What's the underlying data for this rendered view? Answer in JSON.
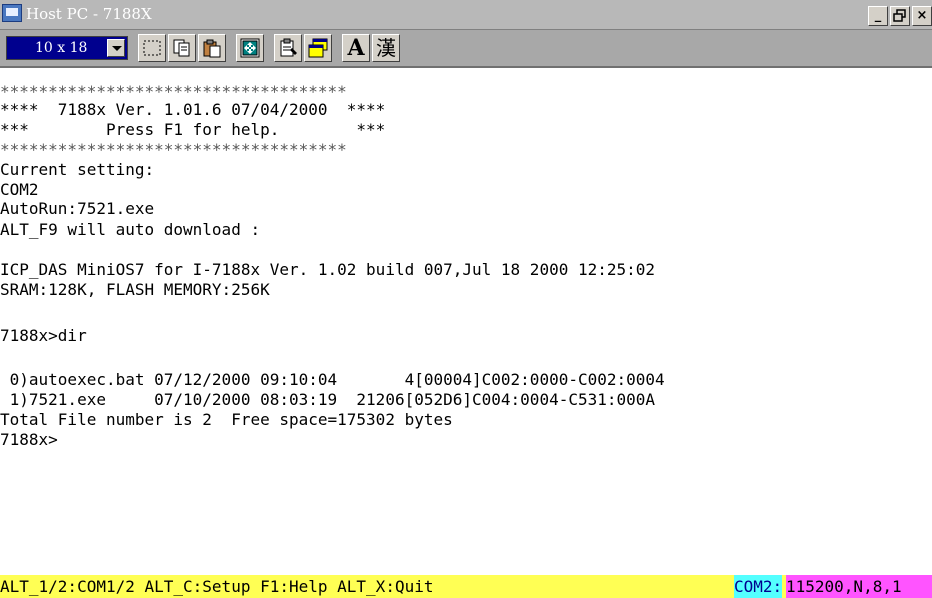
{
  "window": {
    "title": "Host PC - 7188X",
    "minimize_label": "_",
    "restore_label": "▫",
    "close_label": "×"
  },
  "toolbar": {
    "font_size": "10 x 18",
    "buttons": [
      {
        "icon": "select-icon"
      },
      {
        "icon": "copy-icon"
      },
      {
        "icon": "paste-icon"
      },
      {
        "icon": "fullscreen-icon"
      },
      {
        "icon": "properties-icon"
      },
      {
        "icon": "window-icon"
      },
      {
        "icon": "font-icon",
        "label": "A"
      },
      {
        "icon": "chinese-font-icon",
        "label": "漢"
      }
    ]
  },
  "terminal": {
    "lines": [
      "************************************",
      "****  7188x Ver. 1.01.6 07/04/2000  ****",
      "***        Press F1 for help.        ***",
      "************************************",
      "Current setting:",
      "COM2",
      "AutoRun:7521.exe",
      "ALT_F9 will auto download :",
      "",
      "ICP_DAS MiniOS7 for I-7188x Ver. 1.02 build 007,Jul 18 2000 12:25:02",
      "SRAM:128K, FLASH MEMORY:256K",
      "",
      "7188x>dir",
      "",
      " 0)autoexec.bat 07/12/2000 09:10:04       4[00004]C002:0000-C002:0004",
      " 1)7521.exe     07/10/2000 08:03:19  21206[052D6]C004:0004-C531:000A",
      "Total File number is 2  Free space=175302 bytes",
      "7188x>"
    ]
  },
  "statusbar": {
    "shortcuts": "ALT_1/2:COM1/2 ALT_C:Setup F1:Help ALT_X:Quit",
    "port": "COM2:",
    "params": "115200,N,8,1"
  }
}
